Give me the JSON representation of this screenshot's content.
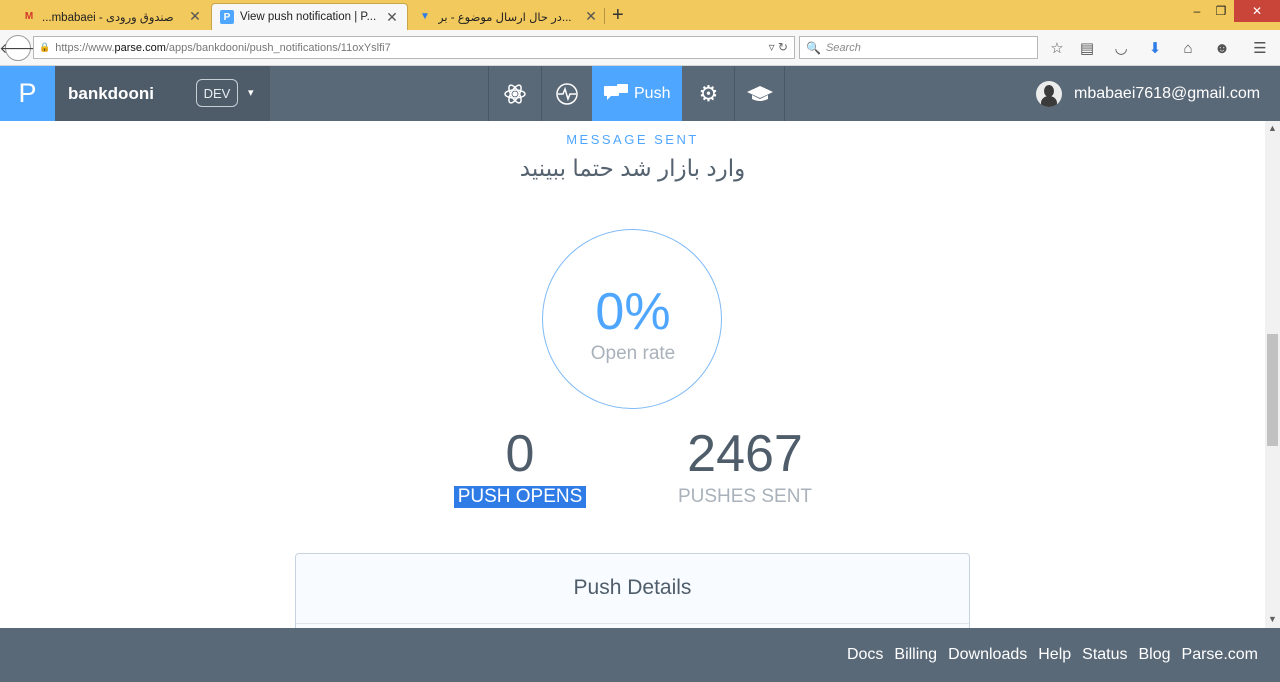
{
  "browser": {
    "tabs": [
      {
        "title": "صندوق ورودی - mbabaei...",
        "icon": "gmail-icon",
        "active": false
      },
      {
        "title": "View push notification | P...",
        "icon": "parse-icon",
        "active": true
      },
      {
        "title": "...در حال ارسال موضوع - بر",
        "icon": "forum-icon",
        "active": false
      }
    ],
    "new_tab": "+",
    "url_prefix": "https://www.",
    "url_host": "parse.com",
    "url_path": "/apps/bankdooni/push_notifications/11oxYslfi7",
    "search_placeholder": "Search",
    "window_buttons": {
      "minimize": "‒",
      "restore": "❐",
      "close": "✕"
    }
  },
  "app": {
    "logo": "P",
    "name": "bankdooni",
    "env_badge": "DEV",
    "caret": "▾",
    "nav": [
      {
        "icon": "react-atom-icon",
        "label": ""
      },
      {
        "icon": "analytics-pulse-icon",
        "label": ""
      },
      {
        "icon": "push-chat-icon",
        "label": "Push",
        "active": true
      },
      {
        "icon": "gear-icon",
        "label": ""
      },
      {
        "icon": "graduation-cap-icon",
        "label": ""
      }
    ],
    "user_email": "mbabaei7618@gmail.com"
  },
  "push": {
    "section_label": "MESSAGE SENT",
    "message": "وارد بازار شد حتما ببینید",
    "open_rate_value": "0%",
    "open_rate_label": "Open rate",
    "push_opens_value": "0",
    "push_opens_label": "PUSH OPENS",
    "pushes_sent_value": "2467",
    "pushes_sent_label": "PUSHES SENT",
    "details_title": "Push Details"
  },
  "footer": {
    "links": [
      "Docs",
      "Billing",
      "Downloads",
      "Help",
      "Status",
      "Blog",
      "Parse.com"
    ]
  },
  "colors": {
    "accent": "#4fa6ff",
    "header_bg": "#5a6978",
    "tab_strip": "#f2c95c",
    "selection": "#2f7ce6"
  }
}
